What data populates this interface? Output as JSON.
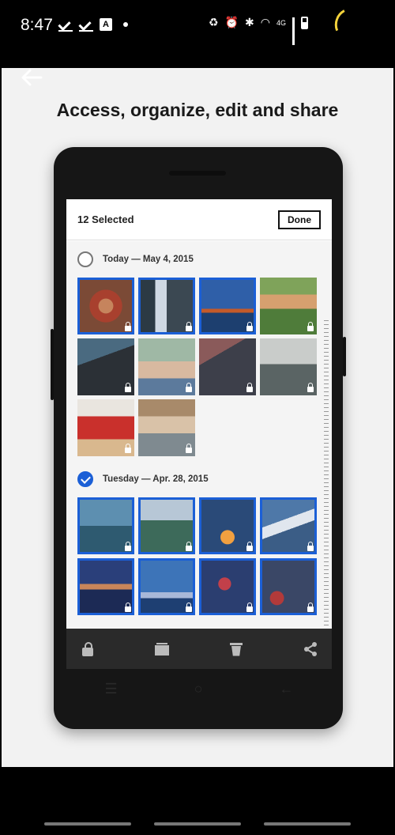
{
  "status_bar": {
    "time": "8:47",
    "left_icons": [
      "check-done-icon",
      "check-done-icon",
      "a-box-icon",
      "dot-icon"
    ],
    "right_icons": [
      "recycle-icon",
      "alarm-icon",
      "bluetooth-icon",
      "wifi-icon",
      "signal-icon",
      "battery-icon"
    ],
    "network_label": "4G",
    "loader_color": "#f3d23b"
  },
  "page": {
    "headline": "Access, organize, edit and share",
    "back_icon": "back-arrow-icon",
    "background": "#f2f2f2"
  },
  "app": {
    "selected_count": "12 Selected",
    "done_label": "Done",
    "accent_color": "#1b5fd6",
    "sections": [
      {
        "title": "Today — May 4, 2015",
        "checked": false,
        "photos": [
          {
            "subject": "wreath",
            "selected": true
          },
          {
            "subject": "waterfall",
            "selected": true
          },
          {
            "subject": "golden-gate-bridge",
            "selected": true
          },
          {
            "subject": "kids-in-field",
            "selected": false
          },
          {
            "subject": "half-dome",
            "selected": false
          },
          {
            "subject": "couple-on-bench",
            "selected": false
          },
          {
            "subject": "mountain-sunset",
            "selected": false
          },
          {
            "subject": "rainy-window",
            "selected": false
          },
          {
            "subject": "woman-in-red",
            "selected": false
          },
          {
            "subject": "child-portrait",
            "selected": false
          }
        ]
      },
      {
        "title": "Tuesday — Apr. 28, 2015",
        "checked": true,
        "photos": [
          {
            "subject": "bird-on-ice",
            "selected": true
          },
          {
            "subject": "snowy-ridge",
            "selected": true
          },
          {
            "subject": "campfire",
            "selected": true
          },
          {
            "subject": "matterhorn",
            "selected": true
          },
          {
            "subject": "dusk-lake",
            "selected": true
          },
          {
            "subject": "blue-mountains",
            "selected": true
          },
          {
            "subject": "bokeh-lights",
            "selected": true
          },
          {
            "subject": "rain-drops",
            "selected": true
          }
        ]
      }
    ],
    "toolbar": [
      "lock-icon",
      "album-icon",
      "trash-icon",
      "share-icon"
    ]
  }
}
